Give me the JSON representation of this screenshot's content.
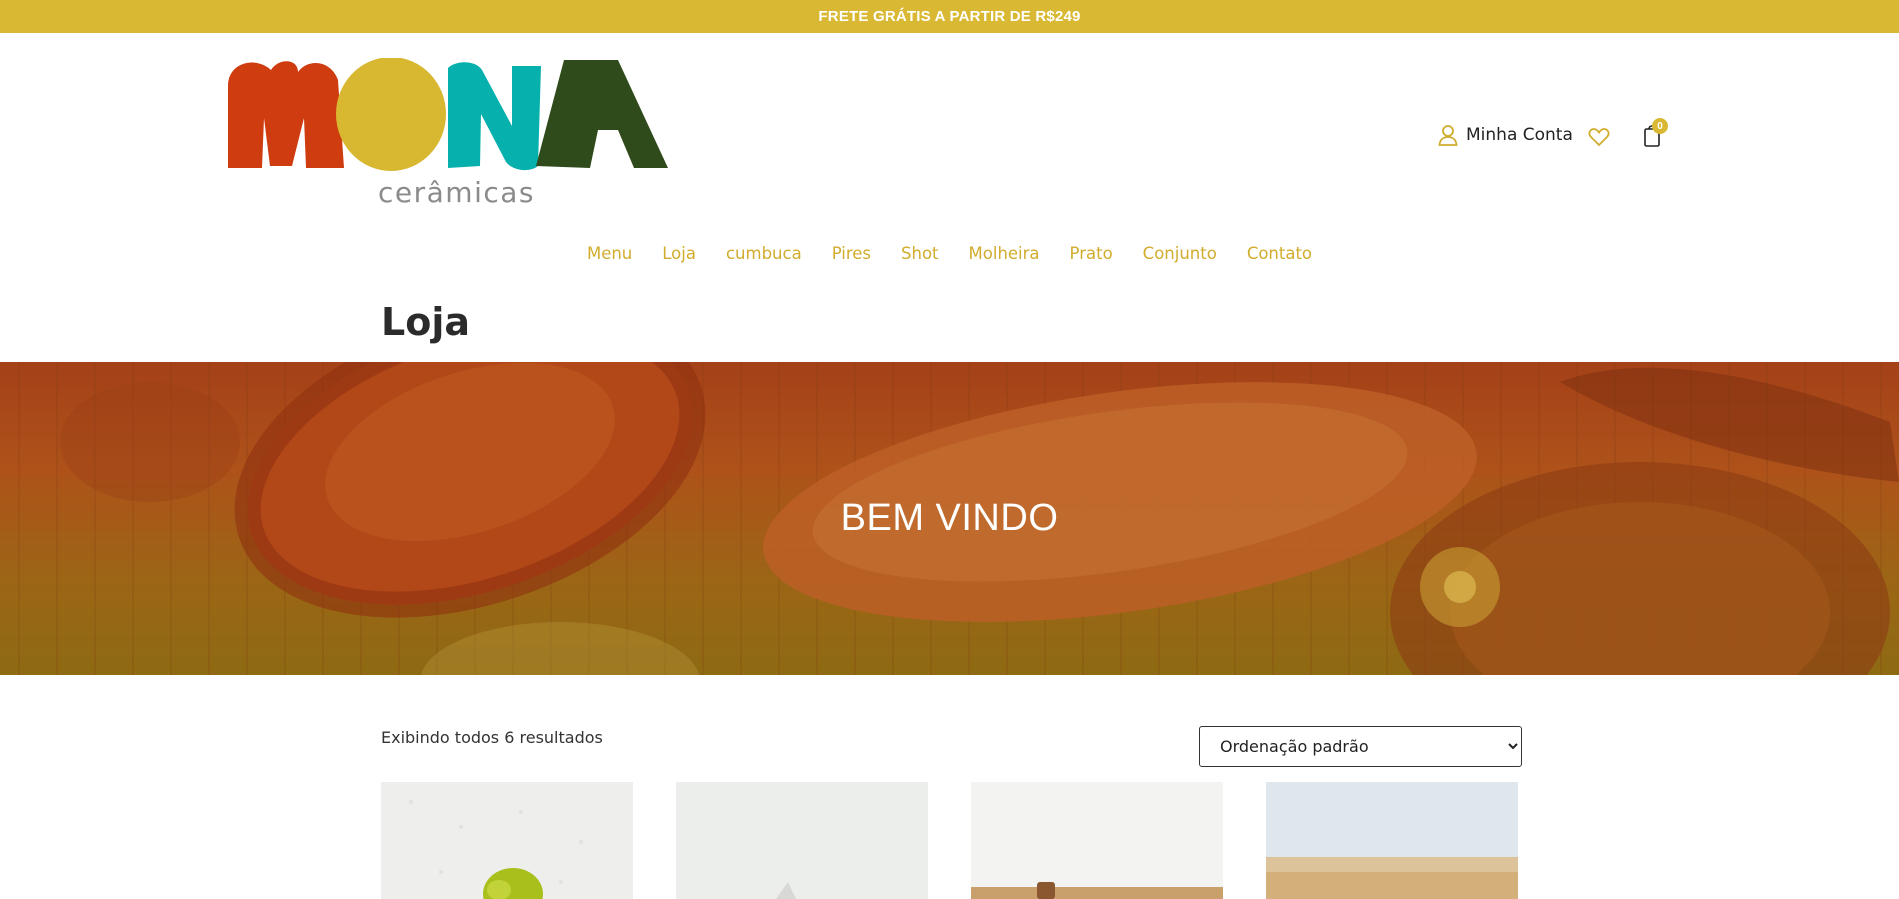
{
  "topbar": {
    "text": "FRETE GRÁTIS A PARTIR DE R$249",
    "bg_color": "#d9b934"
  },
  "logo": {
    "subtitle": "cerâmicas",
    "colors": [
      "#cf3c10",
      "#d8b731",
      "#06b1ad",
      "#2f4b1c"
    ]
  },
  "header": {
    "account_label": "Minha Conta",
    "cart_count": "0",
    "icons": {
      "account": "user-icon",
      "wishlist": "heart-icon",
      "cart": "cart-icon"
    }
  },
  "nav": {
    "items": [
      "Menu",
      "Loja",
      "cumbuca",
      "Pires",
      "Shot",
      "Molheira",
      "Prato",
      "Conjunto",
      "Contato"
    ],
    "color": "#d1ac2d"
  },
  "page": {
    "title": "Loja"
  },
  "hero": {
    "title": "BEM VINDO"
  },
  "shop": {
    "results_text": "Exibindo todos 6 resultados",
    "sort_selected": "Ordenação padrão"
  }
}
